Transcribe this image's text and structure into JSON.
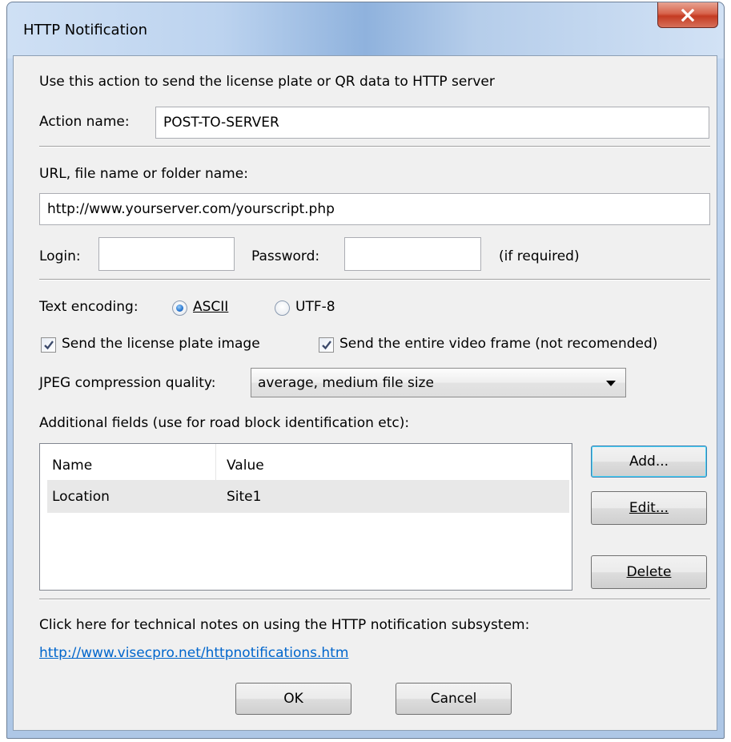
{
  "window": {
    "title": "HTTP Notification",
    "close_icon": "close-x-icon"
  },
  "intro_text": "Use this action to send the license plate or QR data to HTTP server",
  "action_name": {
    "label": "Action name:",
    "value": "POST-TO-SERVER"
  },
  "url": {
    "label": "URL, file name or folder name:",
    "value": "http://www.yourserver.com/yourscript.php"
  },
  "credentials": {
    "login_label": "Login:",
    "login_value": "",
    "password_label": "Password:",
    "password_value": "",
    "hint": "(if required)"
  },
  "encoding": {
    "label": "Text encoding:",
    "options": [
      "ASCII",
      "UTF-8"
    ],
    "selected": "ASCII"
  },
  "checkboxes": {
    "plate_image": {
      "label": "Send the license plate image",
      "checked": true
    },
    "video_frame": {
      "label": "Send the entire video frame (not recomended)",
      "checked": true
    }
  },
  "jpeg": {
    "label": "JPEG compression quality:",
    "selected": "average, medium file size"
  },
  "fields": {
    "label": "Additional fields (use for road block identification etc):",
    "columns": [
      "Name",
      "Value"
    ],
    "rows": [
      {
        "name": "Location",
        "value": "Site1"
      }
    ]
  },
  "buttons": {
    "add": "Add...",
    "edit": "Edit...",
    "delete": "Delete",
    "ok": "OK",
    "cancel": "Cancel"
  },
  "notes": {
    "text": "Click here for technical notes on using the HTTP notification subsystem:",
    "link": "http://www.visecpro.net/httpnotifications.htm"
  },
  "colors": {
    "link": "#0066cc",
    "close_button": "#c43b22",
    "radio_selected": "#2f7dd5"
  }
}
